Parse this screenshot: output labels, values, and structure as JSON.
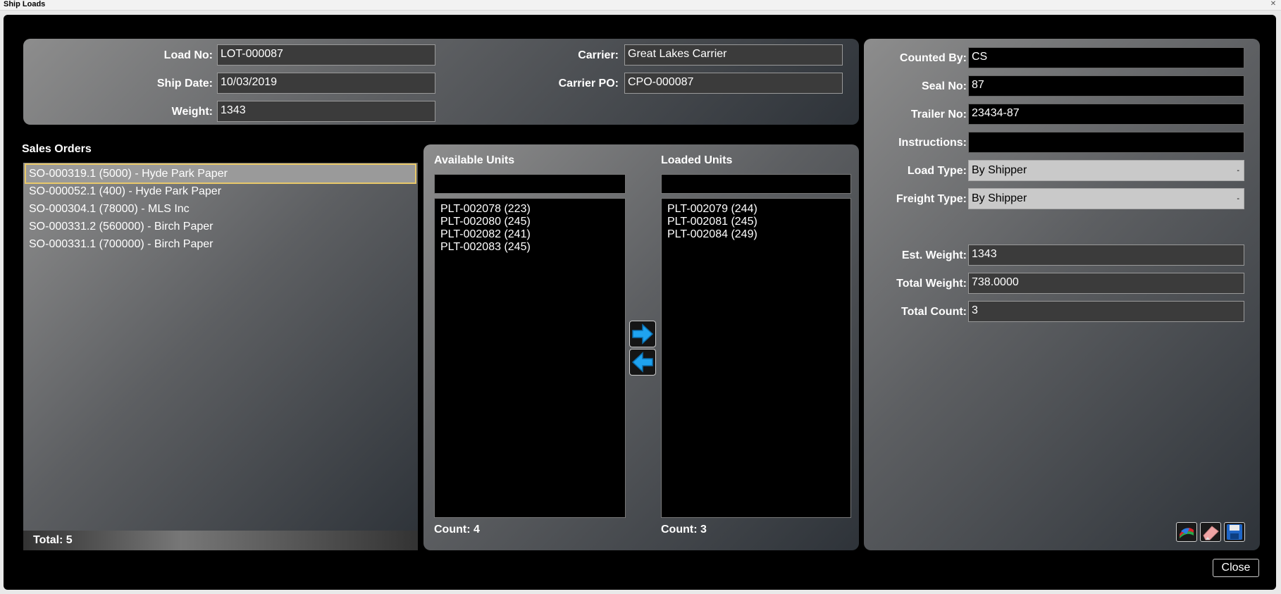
{
  "window": {
    "title": "Ship Loads"
  },
  "header": {
    "load_no_label": "Load No:",
    "load_no": "LOT-000087",
    "ship_date_label": "Ship Date:",
    "ship_date": "10/03/2019",
    "weight_label": "Weight:",
    "weight": "1343",
    "carrier_label": "Carrier:",
    "carrier": "Great Lakes Carrier",
    "carrier_po_label": "Carrier PO:",
    "carrier_po": "CPO-000087"
  },
  "sales_orders": {
    "title": "Sales Orders",
    "items": [
      "SO-000319.1 (5000) - Hyde Park Paper",
      "SO-000052.1 (400) - Hyde Park Paper",
      "SO-000304.1 (78000) - MLS Inc",
      "SO-000331.2 (560000) - Birch Paper",
      "SO-000331.1 (700000) - Birch Paper"
    ],
    "total_label": "Total: 5"
  },
  "units": {
    "available_title": "Available Units",
    "available": [
      "PLT-002078 (223)",
      "PLT-002080 (245)",
      "PLT-002082 (241)",
      "PLT-002083 (245)"
    ],
    "available_count": "Count: 4",
    "loaded_title": "Loaded Units",
    "loaded": [
      "PLT-002079 (244)",
      "PLT-002081 (245)",
      "PLT-002084 (249)"
    ],
    "loaded_count": "Count: 3"
  },
  "details": {
    "counted_by_label": "Counted By:",
    "counted_by": "CS",
    "seal_no_label": "Seal No:",
    "seal_no": "87",
    "trailer_no_label": "Trailer No:",
    "trailer_no": "23434-87",
    "instructions_label": "Instructions:",
    "instructions": "",
    "load_type_label": "Load Type:",
    "load_type": "By Shipper",
    "freight_type_label": "Freight Type:",
    "freight_type": "By Shipper",
    "est_weight_label": "Est. Weight:",
    "est_weight": "1343",
    "total_weight_label": "Total Weight:",
    "total_weight": "738.0000",
    "total_count_label": "Total Count:",
    "total_count": "3"
  },
  "actions": {
    "close_label": "Close",
    "icons": [
      "report-icon",
      "eraser-icon",
      "save-icon"
    ]
  },
  "colors": {
    "arrow_blue": "#1fa3f0",
    "selection_outline": "#e8c86a"
  }
}
